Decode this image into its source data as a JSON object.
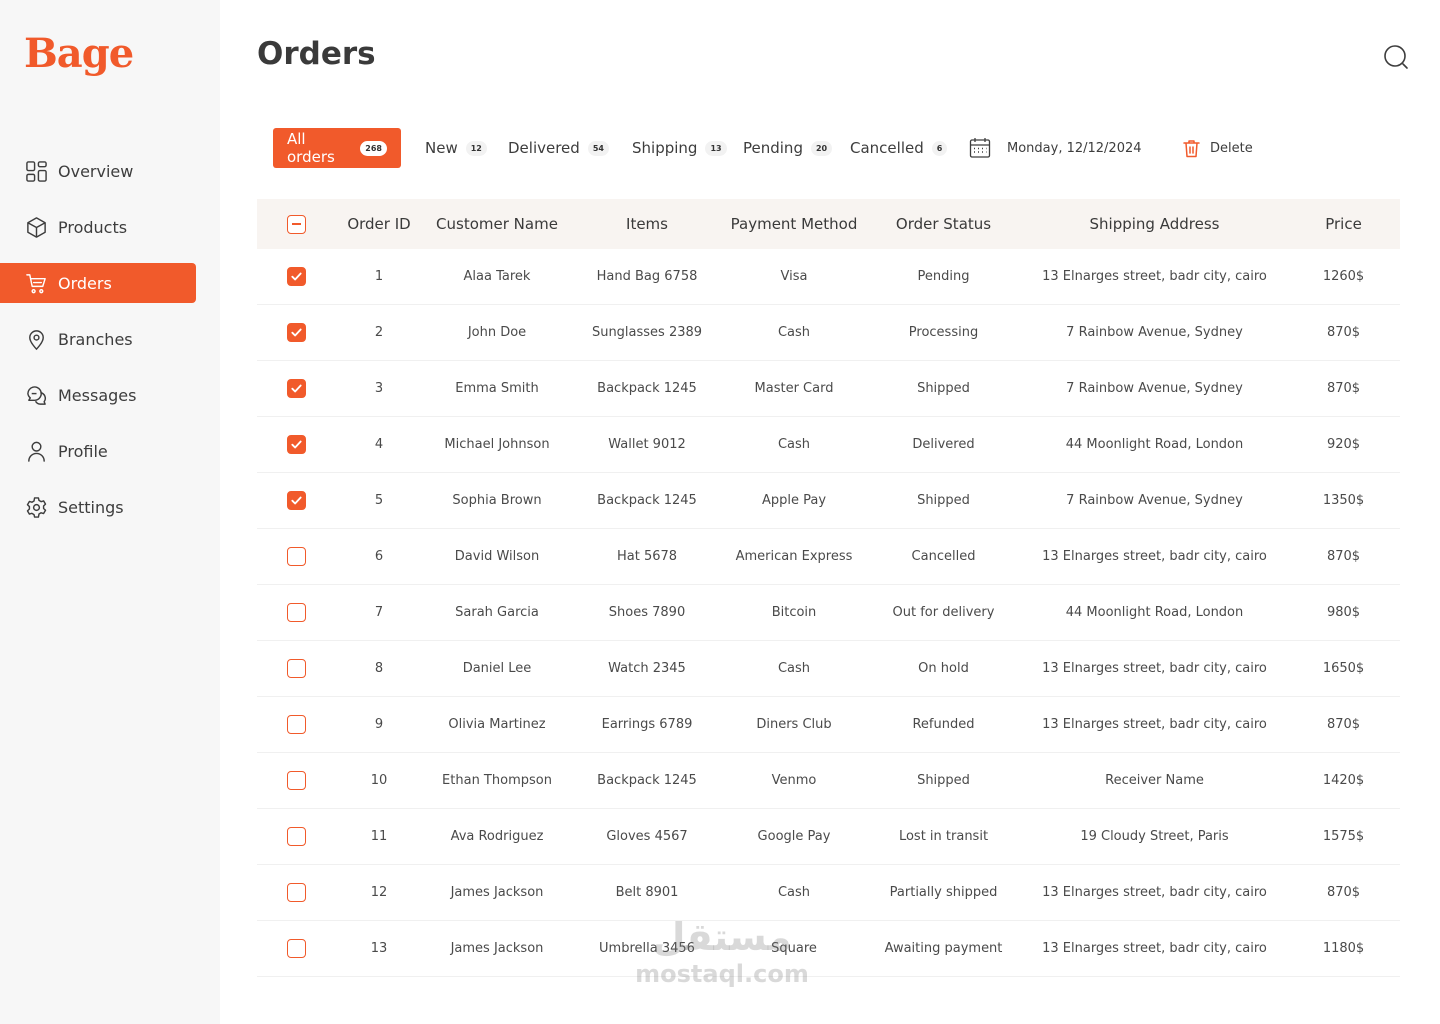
{
  "brand": {
    "logo_text": "Bage",
    "accent": "#f15a2b"
  },
  "sidebar": {
    "items": [
      {
        "label": "Overview",
        "icon": "grid-icon",
        "active": false
      },
      {
        "label": "Products",
        "icon": "box-icon",
        "active": false
      },
      {
        "label": "Orders",
        "icon": "cart-icon",
        "active": true
      },
      {
        "label": "Branches",
        "icon": "location-pin-icon",
        "active": false
      },
      {
        "label": "Messages",
        "icon": "chat-icon",
        "active": false
      },
      {
        "label": "Profile",
        "icon": "user-icon",
        "active": false
      },
      {
        "label": "Settings",
        "icon": "gear-icon",
        "active": false
      }
    ]
  },
  "header": {
    "title": "Orders",
    "search_icon": "search-icon"
  },
  "filters": {
    "tabs": [
      {
        "label": "All orders",
        "count": "268",
        "active": true
      },
      {
        "label": "New",
        "count": "12",
        "active": false
      },
      {
        "label": "Delivered",
        "count": "54",
        "active": false
      },
      {
        "label": "Shipping",
        "count": "13",
        "active": false
      },
      {
        "label": "Pending",
        "count": "20",
        "active": false
      },
      {
        "label": "Cancelled",
        "count": "6",
        "active": false
      }
    ],
    "date": "Monday, 12/12/2024",
    "delete_label": "Delete"
  },
  "table": {
    "columns": [
      "Order ID",
      "Customer Name",
      "Items",
      "Payment Method",
      "Order Status",
      "Shipping Address",
      "Price"
    ],
    "rows": [
      {
        "checked": true,
        "id": "1",
        "customer": "Alaa Tarek",
        "items": "Hand Bag 6758",
        "payment": "Visa",
        "status": "Pending",
        "address": "13 Elnarges street, badr city, cairo",
        "price": "1260$"
      },
      {
        "checked": true,
        "id": "2",
        "customer": "John Doe",
        "items": "Sunglasses 2389",
        "payment": "Cash",
        "status": "Processing",
        "address": "7 Rainbow Avenue, Sydney",
        "price": "870$"
      },
      {
        "checked": true,
        "id": "3",
        "customer": "Emma Smith",
        "items": "Backpack 1245",
        "payment": "Master Card",
        "status": "Shipped",
        "address": "7 Rainbow Avenue, Sydney",
        "price": "870$"
      },
      {
        "checked": true,
        "id": "4",
        "customer": "Michael Johnson",
        "items": "Wallet 9012",
        "payment": "Cash",
        "status": "Delivered",
        "address": "44 Moonlight Road, London",
        "price": "920$"
      },
      {
        "checked": true,
        "id": "5",
        "customer": "Sophia Brown",
        "items": "Backpack 1245",
        "payment": "Apple Pay",
        "status": "Shipped",
        "address": "7 Rainbow Avenue, Sydney",
        "price": "1350$"
      },
      {
        "checked": false,
        "id": "6",
        "customer": "David Wilson",
        "items": "Hat 5678",
        "payment": "American Express",
        "status": "Cancelled",
        "address": "13 Elnarges street, badr city, cairo",
        "price": "870$"
      },
      {
        "checked": false,
        "id": "7",
        "customer": "Sarah Garcia",
        "items": "Shoes 7890",
        "payment": "Bitcoin",
        "status": "Out for delivery",
        "address": "44 Moonlight Road, London",
        "price": "980$"
      },
      {
        "checked": false,
        "id": "8",
        "customer": "Daniel Lee",
        "items": "Watch 2345",
        "payment": "Cash",
        "status": "On hold",
        "address": "13 Elnarges street, badr city, cairo",
        "price": "1650$"
      },
      {
        "checked": false,
        "id": "9",
        "customer": "Olivia Martinez",
        "items": "Earrings 6789",
        "payment": "Diners Club",
        "status": "Refunded",
        "address": "13 Elnarges street, badr city, cairo",
        "price": "870$"
      },
      {
        "checked": false,
        "id": "10",
        "customer": "Ethan Thompson",
        "items": "Backpack 1245",
        "payment": "Venmo",
        "status": "Shipped",
        "address": "Receiver Name",
        "price": "1420$"
      },
      {
        "checked": false,
        "id": "11",
        "customer": "Ava Rodriguez",
        "items": "Gloves 4567",
        "payment": "Google Pay",
        "status": "Lost in transit",
        "address": "19 Cloudy Street, Paris",
        "price": "1575$"
      },
      {
        "checked": false,
        "id": "12",
        "customer": "James Jackson",
        "items": "Belt 8901",
        "payment": "Cash",
        "status": "Partially shipped",
        "address": "13 Elnarges street, badr city, cairo",
        "price": "870$"
      },
      {
        "checked": false,
        "id": "13",
        "customer": "James Jackson",
        "items": "Umbrella 3456",
        "payment": "Square",
        "status": "Awaiting payment",
        "address": "13 Elnarges street, badr city, cairo",
        "price": "1180$"
      }
    ]
  },
  "watermark": {
    "arabic": "مستقل",
    "latin": "mostaql.com"
  }
}
